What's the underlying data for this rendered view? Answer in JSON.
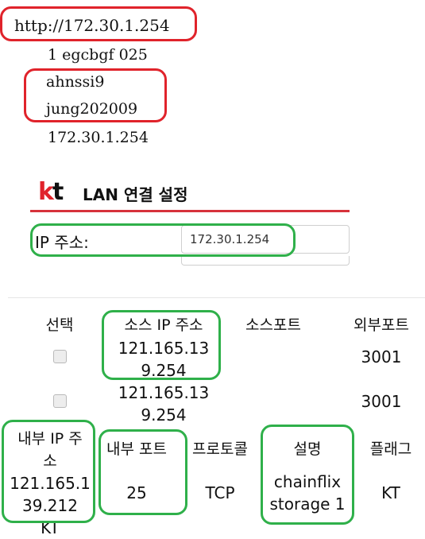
{
  "notes": {
    "url": "http://172.30.1.254",
    "ssid": "1 egcbgf 025",
    "user_id": "ahnssi9",
    "password": "jung202009",
    "ip": "172.30.1.254"
  },
  "kt": {
    "logo_k": "k",
    "logo_t": "t",
    "title": "LAN 연결 설정",
    "ip_label": "IP 주소:",
    "ip_value": "172.30.1.254"
  },
  "table": {
    "headers": {
      "select": "선택",
      "src_ip": "소스 IP 주소",
      "src_port": "소스포트",
      "ext_port": "외부포트"
    },
    "rows": [
      {
        "src_ip_line1": "121.165.13",
        "src_ip_line2": "9.254",
        "ext_port": "3001"
      },
      {
        "src_ip_line1": "121.165.13",
        "src_ip_line2": "9.254",
        "ext_port": "3001"
      }
    ],
    "headers2": {
      "int_ip_line1": "내부 IP 주",
      "int_ip_line2": "소",
      "int_port": "내부 포트",
      "protocol": "프로토콜",
      "desc": "설명",
      "flag": "플래그"
    },
    "row2": {
      "int_ip_line1": "121.165.1",
      "int_ip_line2": "39.212",
      "int_ip_line3": "KT",
      "int_port": "25",
      "protocol": "TCP",
      "desc_line1": "chainflix",
      "desc_line2": "storage 1",
      "flag": "KT"
    }
  },
  "colors": {
    "red_mark": "#e0232b",
    "green_mark": "#2fb04a",
    "kt_red": "#d7323b"
  }
}
